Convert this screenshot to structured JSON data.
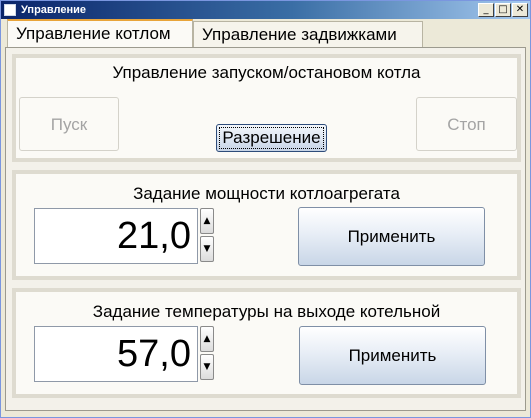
{
  "window": {
    "title": "Управление",
    "minimize_glyph": "_",
    "maximize_glyph": "□",
    "close_glyph": "✕"
  },
  "tabs": [
    {
      "label": "Управление котлом",
      "active": true
    },
    {
      "label": "Управление задвижками",
      "active": false
    }
  ],
  "start_stop": {
    "title": "Управление запуском/остановом котла",
    "start_label": "Пуск",
    "stop_label": "Стоп",
    "permit_label": "Разрешение"
  },
  "power": {
    "title": "Задание мощности котлоагрегата",
    "value": "21,0",
    "apply_label": "Применить"
  },
  "temperature": {
    "title": "Задание температуры на выходе котельной",
    "value": "57,0",
    "apply_label": "Применить"
  },
  "icons": {
    "up": "▲",
    "down": "▼"
  },
  "colors": {
    "active_tab_accent": "#e8a43a",
    "titlebar": "#0a246a"
  }
}
